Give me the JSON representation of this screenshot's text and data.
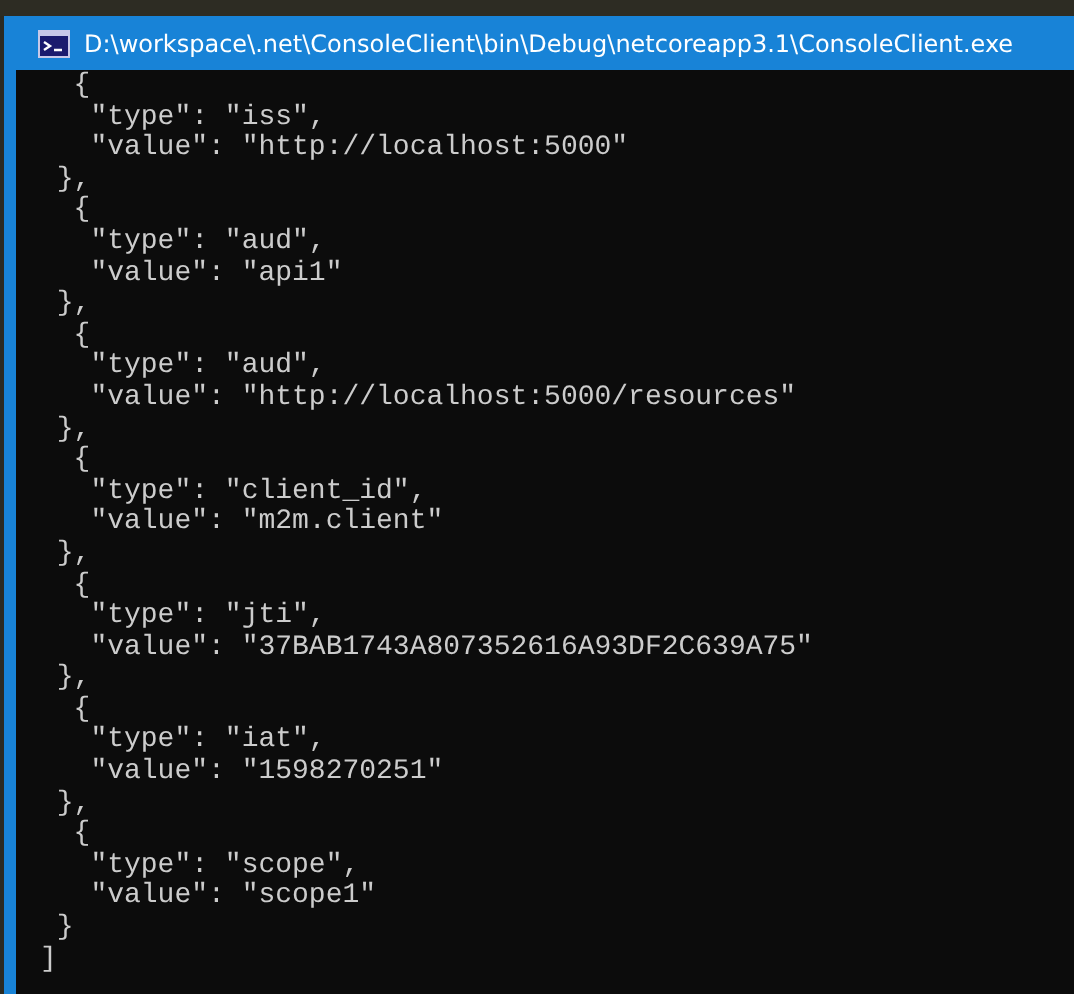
{
  "window": {
    "title": "D:\\workspace\\.net\\ConsoleClient\\bin\\Debug\\netcoreapp3.1\\ConsoleClient.exe"
  },
  "console": {
    "lines": [
      "  {",
      "   \"type\": \"iss\",",
      "   \"value\": \"http://localhost:5000\"",
      " },",
      "  {",
      "   \"type\": \"aud\",",
      "   \"value\": \"api1\"",
      " },",
      "  {",
      "   \"type\": \"aud\",",
      "   \"value\": \"http://localhost:5000/resources\"",
      " },",
      "  {",
      "   \"type\": \"client_id\",",
      "   \"value\": \"m2m.client\"",
      " },",
      "  {",
      "   \"type\": \"jti\",",
      "   \"value\": \"37BAB1743A807352616A93DF2C639A75\"",
      " },",
      "  {",
      "   \"type\": \"iat\",",
      "   \"value\": \"1598270251\"",
      " },",
      "  {",
      "   \"type\": \"scope\",",
      "   \"value\": \"scope1\"",
      " }",
      "]"
    ]
  }
}
